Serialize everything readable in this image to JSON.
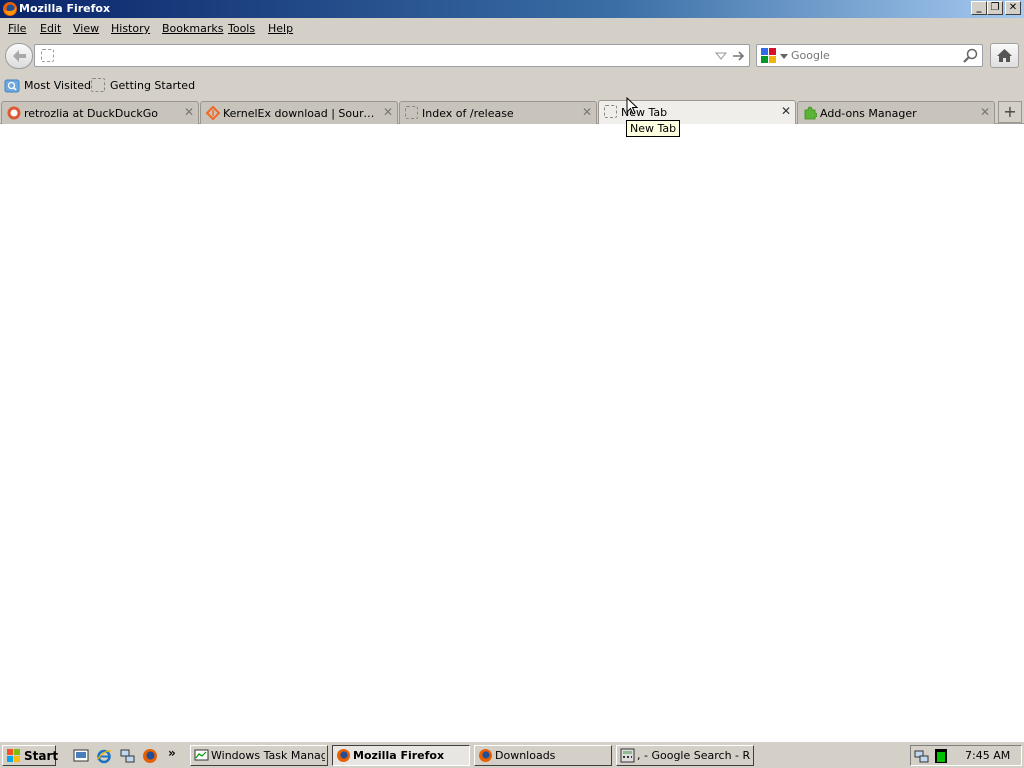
{
  "window": {
    "title": "Mozilla Firefox",
    "min_glyph": "_",
    "max_glyph": "❐",
    "close_glyph": "✕"
  },
  "menu": [
    "File",
    "Edit",
    "View",
    "History",
    "Bookmarks",
    "Tools",
    "Help"
  ],
  "navbar": {
    "url_value": "",
    "search_placeholder": "Google"
  },
  "bookmarks": {
    "items": [
      "Most Visited",
      "Getting Started"
    ]
  },
  "tabs": [
    {
      "label": "retrozlia at DuckDuckGo",
      "icon": "duckduckgo-icon",
      "selected": false
    },
    {
      "label": "KernelEx download | SourceForge.net",
      "icon": "sourceforge-icon",
      "selected": false
    },
    {
      "label": "Index of /release",
      "icon": "blank-page-icon",
      "selected": false
    },
    {
      "label": "New Tab",
      "icon": "blank-page-icon",
      "selected": true
    },
    {
      "label": "Add-ons Manager",
      "icon": "puzzle-icon",
      "selected": false
    }
  ],
  "new_tab_glyph": "+",
  "tooltip": "New Tab",
  "taskbar": {
    "start_label": "Start",
    "overflow_glyph": "»",
    "tasks": [
      {
        "label": "Windows Task Manager",
        "icon": "task-manager-icon",
        "active": false
      },
      {
        "label": "Mozilla Firefox",
        "icon": "firefox-icon",
        "active": true
      },
      {
        "label": "Downloads",
        "icon": "firefox-icon",
        "active": false
      },
      {
        "label": ", - Google Search - R...",
        "icon": "calculator-icon",
        "active": false
      }
    ],
    "clock": "7:45 AM"
  },
  "colors": {
    "titlebar_start": "#0a246a",
    "titlebar_end": "#a6caf0",
    "chrome": "#d4d0c8",
    "tooltip_bg": "#ffffe1"
  }
}
